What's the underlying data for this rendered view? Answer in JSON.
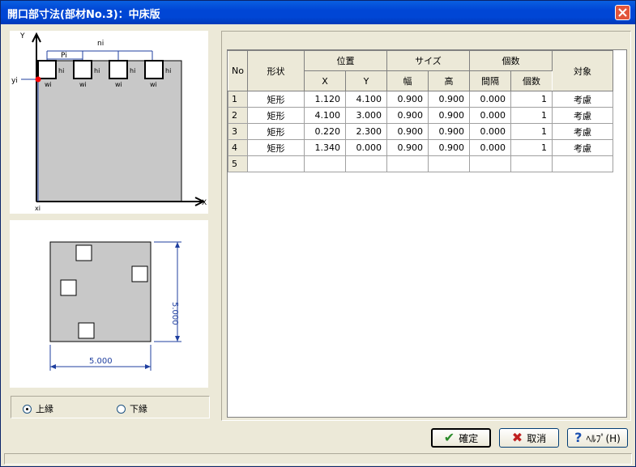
{
  "window": {
    "title": "開口部寸法(部材No.3)：中床版"
  },
  "diagram_top": {
    "axis_y": "Y",
    "axis_x": "X",
    "label_ni": "ni",
    "label_pi": "Pi",
    "label_yi": "yi",
    "label_xi": "xi",
    "label_hi": "hi",
    "label_wi": "wi"
  },
  "preview": {
    "width_label": "5.000",
    "height_label": "5.000"
  },
  "grid": {
    "header": {
      "no": "No",
      "shape": "形状",
      "position": "位置",
      "size": "サイズ",
      "count_group": "個数",
      "target": "対象",
      "x": "X",
      "y": "Y",
      "width": "幅",
      "height": "高",
      "interval": "間隔",
      "count": "個数"
    },
    "rows": [
      {
        "no": "1",
        "shape": "矩形",
        "x": "1.120",
        "y": "4.100",
        "w": "0.900",
        "h": "0.900",
        "interval": "0.000",
        "count": "1",
        "target": "考慮"
      },
      {
        "no": "2",
        "shape": "矩形",
        "x": "4.100",
        "y": "3.000",
        "w": "0.900",
        "h": "0.900",
        "interval": "0.000",
        "count": "1",
        "target": "考慮"
      },
      {
        "no": "3",
        "shape": "矩形",
        "x": "0.220",
        "y": "2.300",
        "w": "0.900",
        "h": "0.900",
        "interval": "0.000",
        "count": "1",
        "target": "考慮"
      },
      {
        "no": "4",
        "shape": "矩形",
        "x": "1.340",
        "y": "0.000",
        "w": "0.900",
        "h": "0.900",
        "interval": "0.000",
        "count": "1",
        "target": "考慮"
      },
      {
        "no": "5",
        "shape": "",
        "x": "",
        "y": "",
        "w": "",
        "h": "",
        "interval": "",
        "count": "",
        "target": ""
      }
    ]
  },
  "radio": {
    "upper": "上縁",
    "lower": "下縁",
    "selected": "upper"
  },
  "buttons": {
    "ok": "確定",
    "cancel": "取消",
    "help": "ﾍﾙﾌﾟ(H)"
  },
  "colors": {
    "titlebar": "#0046d5",
    "slab": "#c8c8c8",
    "dim": "#1f3f9f",
    "marker": "#ff0000"
  }
}
